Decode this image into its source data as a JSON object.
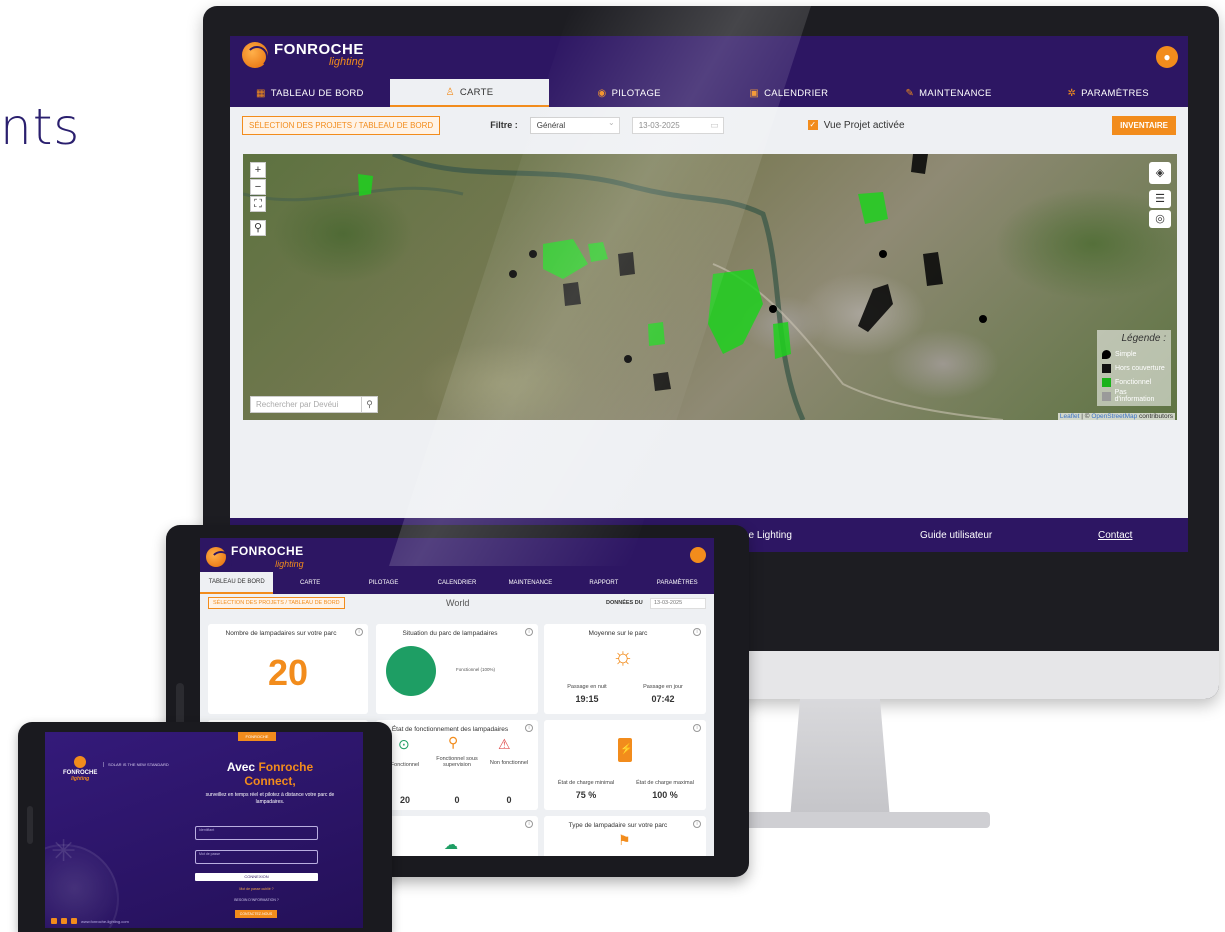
{
  "edge_text": "nts",
  "desktop": {
    "brand": {
      "name": "FONROCHE",
      "sub": "lighting"
    },
    "nav": [
      {
        "label": "TABLEAU DE BORD",
        "icon": "grid-icon"
      },
      {
        "label": "CARTE",
        "icon": "person-pin-icon"
      },
      {
        "label": "PILOTAGE",
        "icon": "dial-icon"
      },
      {
        "label": "CALENDRIER",
        "icon": "calendar-icon"
      },
      {
        "label": "MAINTENANCE",
        "icon": "wrench-icon"
      },
      {
        "label": "PARAMÈTRES",
        "icon": "gear-icon"
      }
    ],
    "active_tab": "CARTE",
    "selection_button": "SÉLECTION DES PROJETS / TABLEAU DE BORD",
    "filter_label": "Filtre :",
    "filter_value": "Général",
    "date_value": "13-03-2025",
    "checkbox_label": "Vue Projet activée",
    "inventory_button": "INVENTAIRE",
    "map": {
      "search_placeholder": "Rechercher par Devéui",
      "legend_title": "Légende :",
      "legend": [
        {
          "label": "Simple",
          "color": "#000000"
        },
        {
          "label": "Hors couverture",
          "color": "#111111"
        },
        {
          "label": "Fonctionnel",
          "color": "#19b219"
        },
        {
          "label": "Pas d'information",
          "color": "#9a9a9a"
        }
      ],
      "attribution_leaflet": "Leaflet",
      "attribution_sep": " | © ",
      "attribution_osm": "OpenStreetMap",
      "attribution_tail": " contributors"
    },
    "footer": {
      "company": "che Lighting",
      "guide": "Guide utilisateur",
      "contact": "Contact"
    }
  },
  "tablet": {
    "brand": {
      "name": "FONROCHE",
      "sub": "lighting"
    },
    "nav": [
      {
        "label": "TABLEAU DE BORD"
      },
      {
        "label": "CARTE"
      },
      {
        "label": "PILOTAGE"
      },
      {
        "label": "CALENDRIER"
      },
      {
        "label": "MAINTENANCE"
      },
      {
        "label": "RAPPORT"
      },
      {
        "label": "PARAMÈTRES"
      }
    ],
    "selection_button": "SÉLECTION DES PROJETS / TABLEAU DE BORD",
    "world_label": "World",
    "donnees_label": "DONNÉES DU",
    "date_value": "13-03-2025",
    "cards": {
      "count_title": "Nombre de lampadaires sur votre parc",
      "count_value": "20",
      "situation_title": "Situation du parc de lampadaires",
      "pie_legend": "Fonctionnel (100%)",
      "average_title": "Moyenne sur le parc",
      "night_label": "Passage en nuit",
      "night_value": "19:15",
      "day_label": "Passage en jour",
      "day_value": "07:42",
      "state_title": "État de fonctionnement des lampadaires",
      "functional_label": "Fonctionnel",
      "functional_value": "20",
      "supervision_label": "Fonctionnel sous supervision",
      "supervision_value": "0",
      "nonfunctional_label": "Non fonctionnel",
      "nonfunctional_value": "0",
      "charge_min_label": "État de charge minimal",
      "charge_min_value": "75 %",
      "charge_max_label": "État de charge maximal",
      "charge_max_value": "100 %",
      "type_title": "Type de lampadaire sur votre parc"
    }
  },
  "phone": {
    "badge": "FONROCHE",
    "brand": "FONROCHE",
    "brand_sub": "lighting",
    "tagline": "SOLAR IS THE NEW STANDARD",
    "heading_1": "Avec",
    "heading_2": "Fonroche",
    "heading_3": "Connect,",
    "description": "surveillez en temps réel et pilotez à distance votre parc de lampadaires.",
    "id_label": "Identifiant",
    "pwd_label": "Mot de passe",
    "login_button": "CONNEXION",
    "forgot": "Mot de passe oublié ?",
    "help": "BESOIN D'INFORMATION ?",
    "contact_button": "CONTACTEZ-NOUS",
    "website": "www.fonroche-lighting.com"
  }
}
